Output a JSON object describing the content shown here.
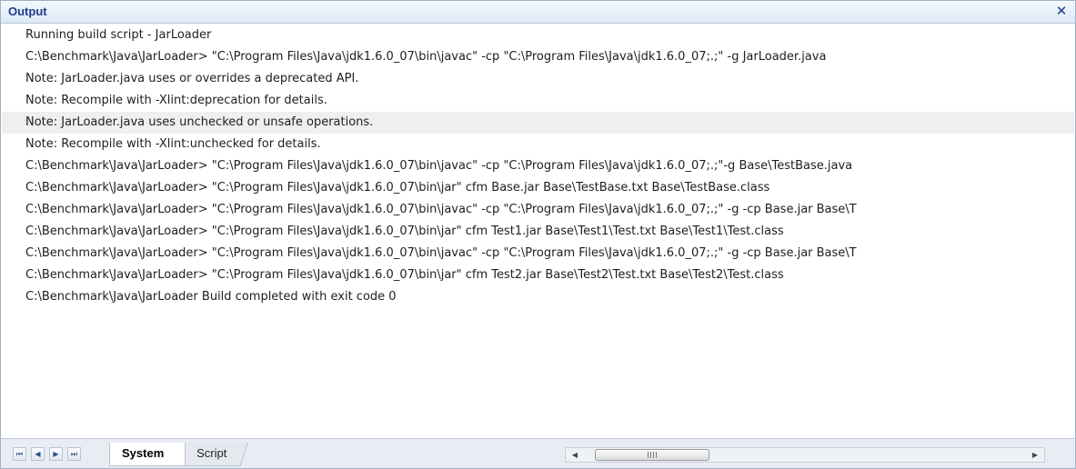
{
  "panel": {
    "title": "Output",
    "close_glyph": "✕"
  },
  "output_lines": [
    "Running build script - JarLoader",
    "C:\\Benchmark\\Java\\JarLoader> \"C:\\Program Files\\Java\\jdk1.6.0_07\\bin\\javac\" -cp \"C:\\Program Files\\Java\\jdk1.6.0_07;.;\" -g JarLoader.java",
    "Note: JarLoader.java uses or overrides a deprecated API.",
    "Note: Recompile with -Xlint:deprecation for details.",
    "Note: JarLoader.java uses unchecked or unsafe operations.",
    "Note: Recompile with -Xlint:unchecked for details.",
    "C:\\Benchmark\\Java\\JarLoader> \"C:\\Program Files\\Java\\jdk1.6.0_07\\bin\\javac\" -cp \"C:\\Program Files\\Java\\jdk1.6.0_07;.;\"-g Base\\TestBase.java",
    "C:\\Benchmark\\Java\\JarLoader> \"C:\\Program Files\\Java\\jdk1.6.0_07\\bin\\jar\" cfm Base.jar Base\\TestBase.txt Base\\TestBase.class",
    "C:\\Benchmark\\Java\\JarLoader> \"C:\\Program Files\\Java\\jdk1.6.0_07\\bin\\javac\" -cp \"C:\\Program Files\\Java\\jdk1.6.0_07;.;\" -g -cp Base.jar Base\\T",
    "C:\\Benchmark\\Java\\JarLoader> \"C:\\Program Files\\Java\\jdk1.6.0_07\\bin\\jar\" cfm Test1.jar Base\\Test1\\Test.txt Base\\Test1\\Test.class",
    "C:\\Benchmark\\Java\\JarLoader> \"C:\\Program Files\\Java\\jdk1.6.0_07\\bin\\javac\" -cp \"C:\\Program Files\\Java\\jdk1.6.0_07;.;\" -g -cp Base.jar Base\\T",
    "C:\\Benchmark\\Java\\JarLoader> \"C:\\Program Files\\Java\\jdk1.6.0_07\\bin\\jar\" cfm Test2.jar Base\\Test2\\Test.txt Base\\Test2\\Test.class",
    "C:\\Benchmark\\Java\\JarLoader Build completed with exit code 0"
  ],
  "highlighted_line_index": 4,
  "tabs": [
    {
      "label": "System",
      "active": true
    },
    {
      "label": "Script",
      "active": false
    }
  ],
  "nav": {
    "first_glyph": "⏮",
    "prev_glyph": "◀",
    "next_glyph": "▶",
    "last_glyph": "⏭"
  },
  "scrollbar": {
    "left_glyph": "◀",
    "right_glyph": "▶"
  },
  "colors": {
    "title": "#1d3d8c",
    "highlight_row": "#efefef"
  }
}
